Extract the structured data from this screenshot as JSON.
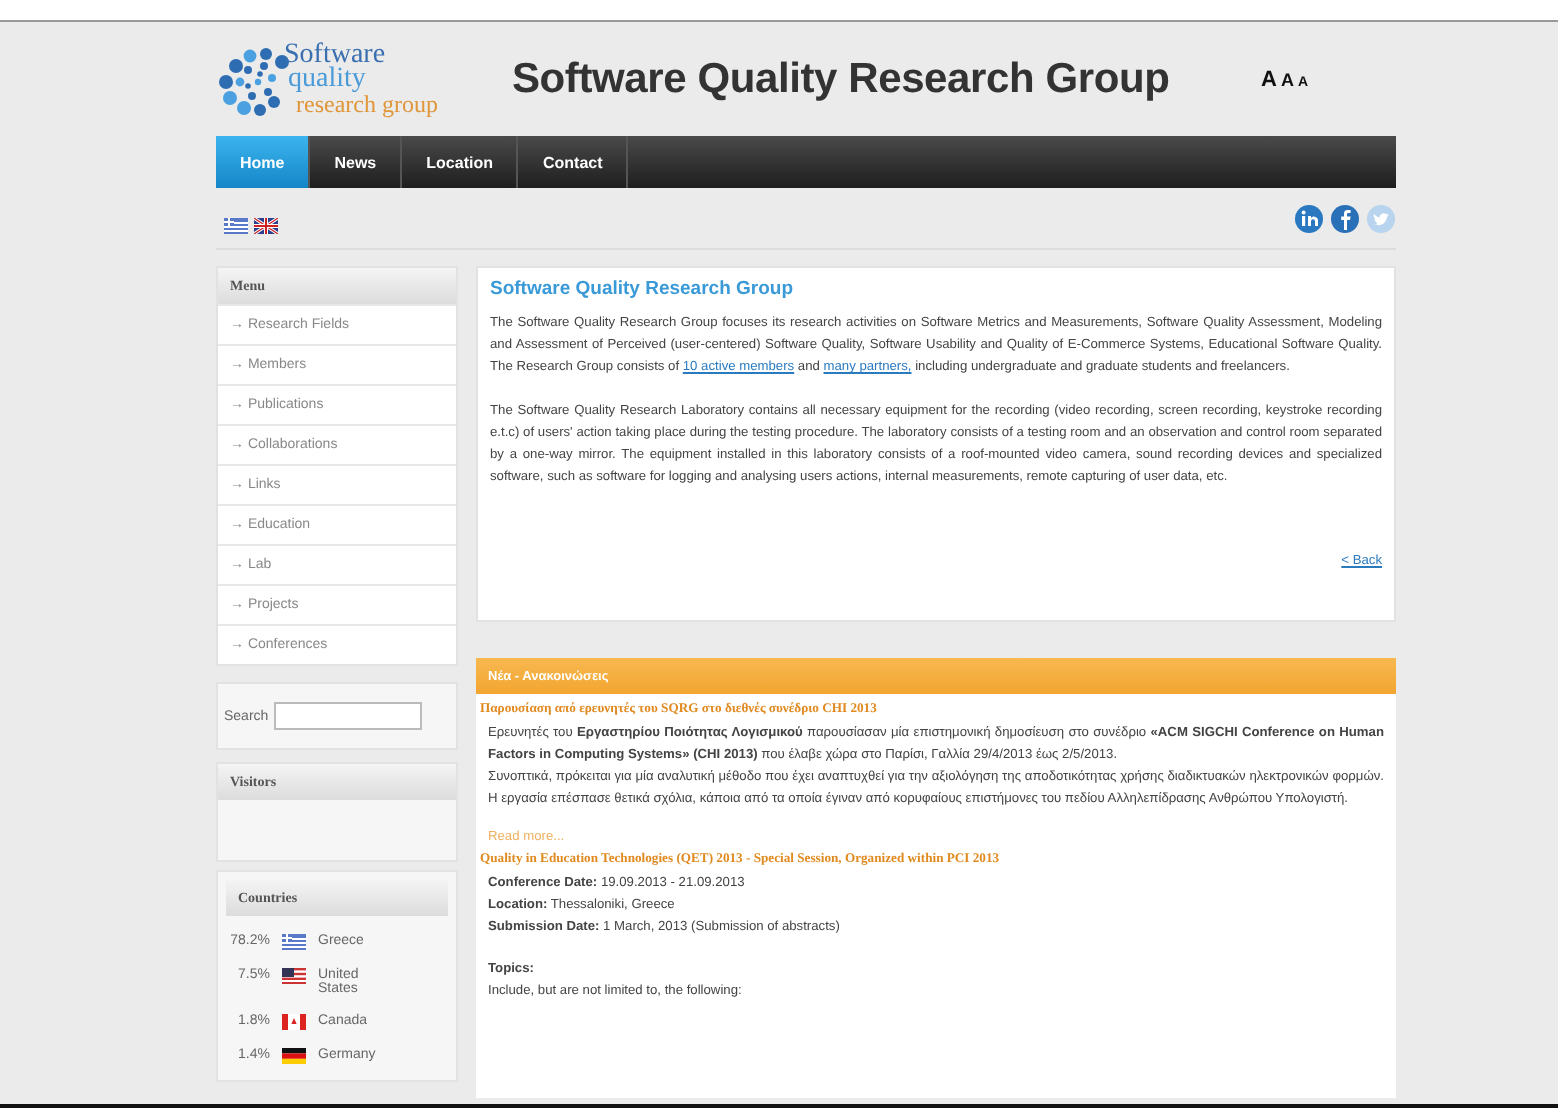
{
  "header": {
    "logo_lines": [
      "Software",
      "quality",
      "research group"
    ],
    "title": "Software Quality Research Group",
    "font_size_buttons": [
      "A",
      "A",
      "A"
    ]
  },
  "nav": {
    "tabs": [
      {
        "label": "Home",
        "selected": true
      },
      {
        "label": "News",
        "selected": false
      },
      {
        "label": "Location",
        "selected": false
      },
      {
        "label": "Contact",
        "selected": false
      }
    ]
  },
  "sidebar": {
    "menu_title": "Menu",
    "menu_items": [
      {
        "label": "→ Research Fields"
      },
      {
        "label": "→ Members"
      },
      {
        "label": "→ Publications"
      },
      {
        "label": "→ Collaborations"
      },
      {
        "label": "→ Links"
      },
      {
        "label": "→ Education"
      },
      {
        "label": "→ Lab"
      },
      {
        "label": "→ Projects"
      },
      {
        "label": "→ Conferences"
      }
    ],
    "search_label": "Search",
    "visitors_title": "Visitors",
    "countries_title": "Countries",
    "countries": [
      {
        "percent": "78.2%",
        "name": "Greece"
      },
      {
        "percent": "7.5%",
        "name": "United States"
      },
      {
        "percent": "1.8%",
        "name": "Canada"
      },
      {
        "percent": "1.4%",
        "name": "Germany"
      }
    ]
  },
  "article": {
    "title": "Software Quality Research Group",
    "paragraphs": [
      [
        {
          "text": "The Software Quality Research Group focuses its research activities on Software Metrics and Measurements, Software Quality Assessment, Modeling and Assessment of Perceived (user-centered) Software Quality, Software Usability and Quality of E-Commerce Systems, Educational Software Quality. The Research Group consists of "
        },
        {
          "kind": "link",
          "text": "10 active members"
        },
        {
          "text": " and "
        },
        {
          "kind": "link",
          "text": "many partners,"
        },
        {
          "text": " including undergraduate and graduate students and freelancers."
        }
      ],
      [
        {
          "text": "The Software Quality Research Laboratory contains all necessary equipment for the recording (video recording, screen recording, keystroke recording e.t.c) of users' action taking place during the testing procedure. The laboratory consists of a testing room and an observation and control room separated by a one-way mirror. The equipment installed in this laboratory consists of a roof-mounted video camera, sound recording devices and specialized software, such as software for logging and analysing users actions, internal measurements, remote capturing of user data, etc."
        }
      ]
    ],
    "back_link": "< Back"
  },
  "news": {
    "title": "Νέα - Ανακοινώσεις",
    "items": [
      {
        "title": "Παρουσίαση από ερευνητές του SQRG στο διεθνές συνέδριο CHI 2013",
        "paragraphs": [
          "Ερευνητές του **Εργαστηρίου Ποιότητας Λογισμικού** παρουσίασαν μία επιστημονική δημοσίευση στο συνέδριο **«ACM SIGCHI Conference on Human Factors in Computing Systems» (CHI 2013)** που έλαβε χώρα στο Παρίσι, Γαλλία 29/4/2013 έως 2/5/2013.",
          "Συνοπτικά, πρόκειται για μία αναλυτική μέθοδο που έχει αναπτυχθεί για την αξιολόγηση της αποδοτικότητας χρήσης διαδικτυακών ηλεκτρονικών φορμών. Η εργασία επέσπασε θετικά σχόλια, κάποια από τα οποία έγιναν από κορυφαίους επιστήμονες του πεδίου Αλληλεπίδρασης Ανθρώπου Υπολογιστή."
        ],
        "read_more": "Read more..."
      },
      {
        "title": "Quality in Education Technologies (QET) 2013 - Special Session, Organized within PCI 2013",
        "fields": [
          {
            "label": "Conference Date:",
            "value": "19.09.2013 - 21.09.2013"
          },
          {
            "label": "Location:",
            "value": "Thessaloniki, Greece"
          },
          {
            "label": "Submission Date:",
            "value": "1 March, 2013 (Submission of abstracts)"
          }
        ],
        "topics_label": "Topics:",
        "topics_text": "Include, but are not limited to, the following:"
      }
    ]
  }
}
